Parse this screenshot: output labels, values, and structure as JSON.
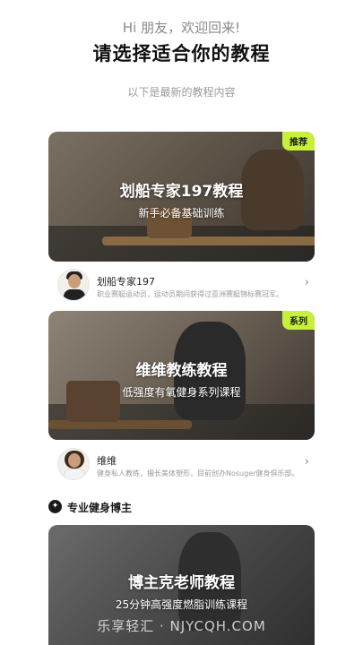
{
  "header": {
    "greeting": "Hi 朋友，欢迎回来!",
    "title": "请选择适合你的教程",
    "subtitle": "以下是最新的教程内容"
  },
  "courses": [
    {
      "badge": "推荐",
      "title": "划船专家197教程",
      "subtitle": "新手必备基础训练",
      "coach": {
        "name": "划船专家197",
        "desc": "职业赛艇运动员，运动员期间获得过亚洲赛艇锦标赛冠军。"
      }
    },
    {
      "badge": "系列",
      "title": "维维教练教程",
      "subtitle": "低强度有氧健身系列课程",
      "coach": {
        "name": "维维",
        "desc": "健身私人教练，擅长美体塑形，目前创办Nosuger健身俱乐部。"
      }
    }
  ],
  "section": {
    "icon": "fitness-blogger-icon",
    "title": "专业健身博主"
  },
  "blogger_course": {
    "title": "博主克老师教程",
    "subtitle": "25分钟高强度燃脂训练课程"
  },
  "watermark": "乐享轻汇 · NJYCQH.COM",
  "colors": {
    "badge": "#c7f03a",
    "background": "#ffffff",
    "muted_text": "#9a9a9a"
  }
}
